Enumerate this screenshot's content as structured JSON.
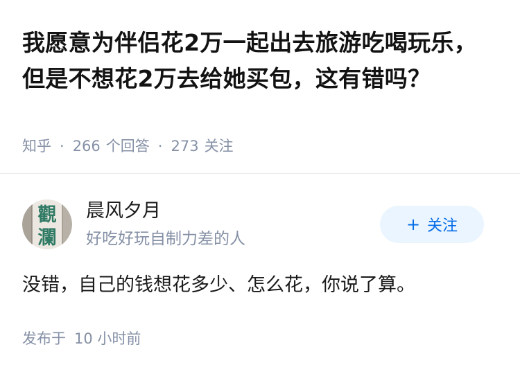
{
  "question": {
    "title": "我愿意为伴侣花2万一起出去旅游吃喝玩乐，但是不想花2万去给她买包，这有错吗？",
    "source": "知乎",
    "answer_count": "266",
    "answer_label": "个回答",
    "follower_count": "273",
    "follower_label": "关注"
  },
  "answer": {
    "author_name": "晨风夕月",
    "author_bio": "好吃好玩自制力差的人",
    "avatar_text": "觀瀾",
    "follow_label": "关注",
    "content": "没错，自己的钱想花多少、怎么花，你说了算。",
    "published_label": "发布于",
    "published_time": "10 小时前"
  },
  "colors": {
    "title": "#121212",
    "meta": "#8590a6",
    "accent": "#056de8",
    "follow_bg": "#ebf5ff",
    "divider": "#ebebeb",
    "avatar_glyph": "#2f7a64"
  }
}
